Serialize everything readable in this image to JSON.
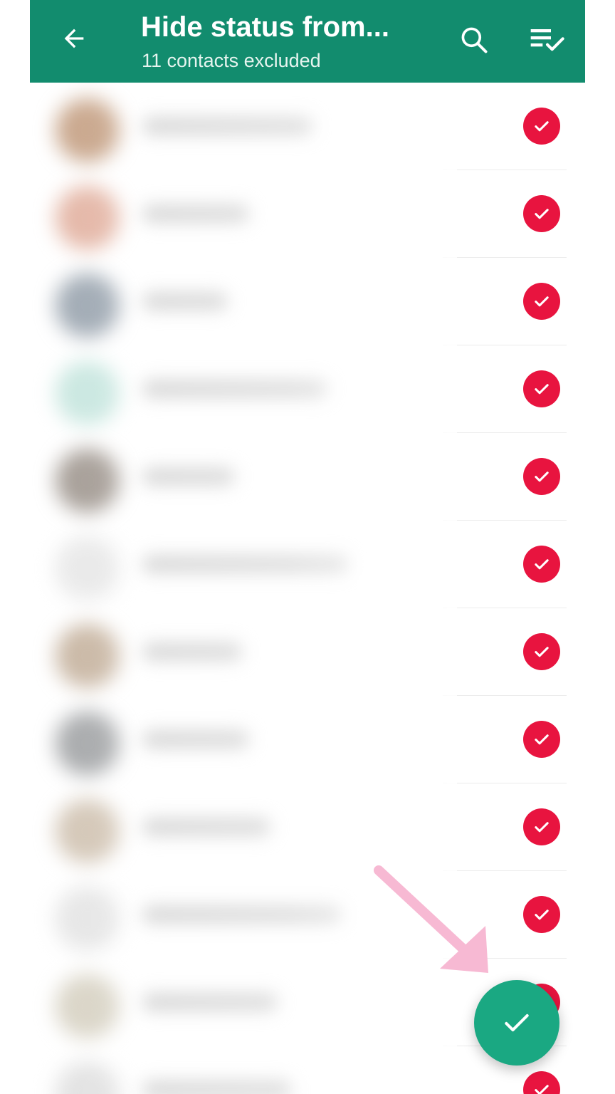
{
  "appbar": {
    "title": "Hide status from...",
    "subtitle": "11 contacts excluded",
    "back_icon": "arrow-left-icon",
    "search_icon": "search-icon",
    "select_all_icon": "select-all-checklist-icon",
    "background_color": "#128c6e"
  },
  "contacts": [
    {
      "avatar_color": "#c8a58a",
      "selected": true
    },
    {
      "avatar_color": "#e4b6a6",
      "selected": true
    },
    {
      "avatar_color": "#9fa9b3",
      "selected": true
    },
    {
      "avatar_color": "#c9e7e0",
      "selected": true
    },
    {
      "avatar_color": "#a59d96",
      "selected": true
    },
    {
      "avatar_color": "#e9e9e9",
      "selected": true
    },
    {
      "avatar_color": "#c9b7a4",
      "selected": true
    },
    {
      "avatar_color": "#a7a9ab",
      "selected": true
    },
    {
      "avatar_color": "#d3c6b6",
      "selected": true
    },
    {
      "avatar_color": "#e6e6e6",
      "selected": true
    },
    {
      "avatar_color": "#d9d4c6",
      "selected": true
    },
    {
      "avatar_color": "#e2e2e2",
      "selected": true
    }
  ],
  "selected_check_color": "#e8143f",
  "fab": {
    "icon": "checkmark-icon",
    "color": "#1aa882"
  },
  "annotation": {
    "icon": "pink-arrow-pointer-icon",
    "color": "#f7b9d3"
  }
}
